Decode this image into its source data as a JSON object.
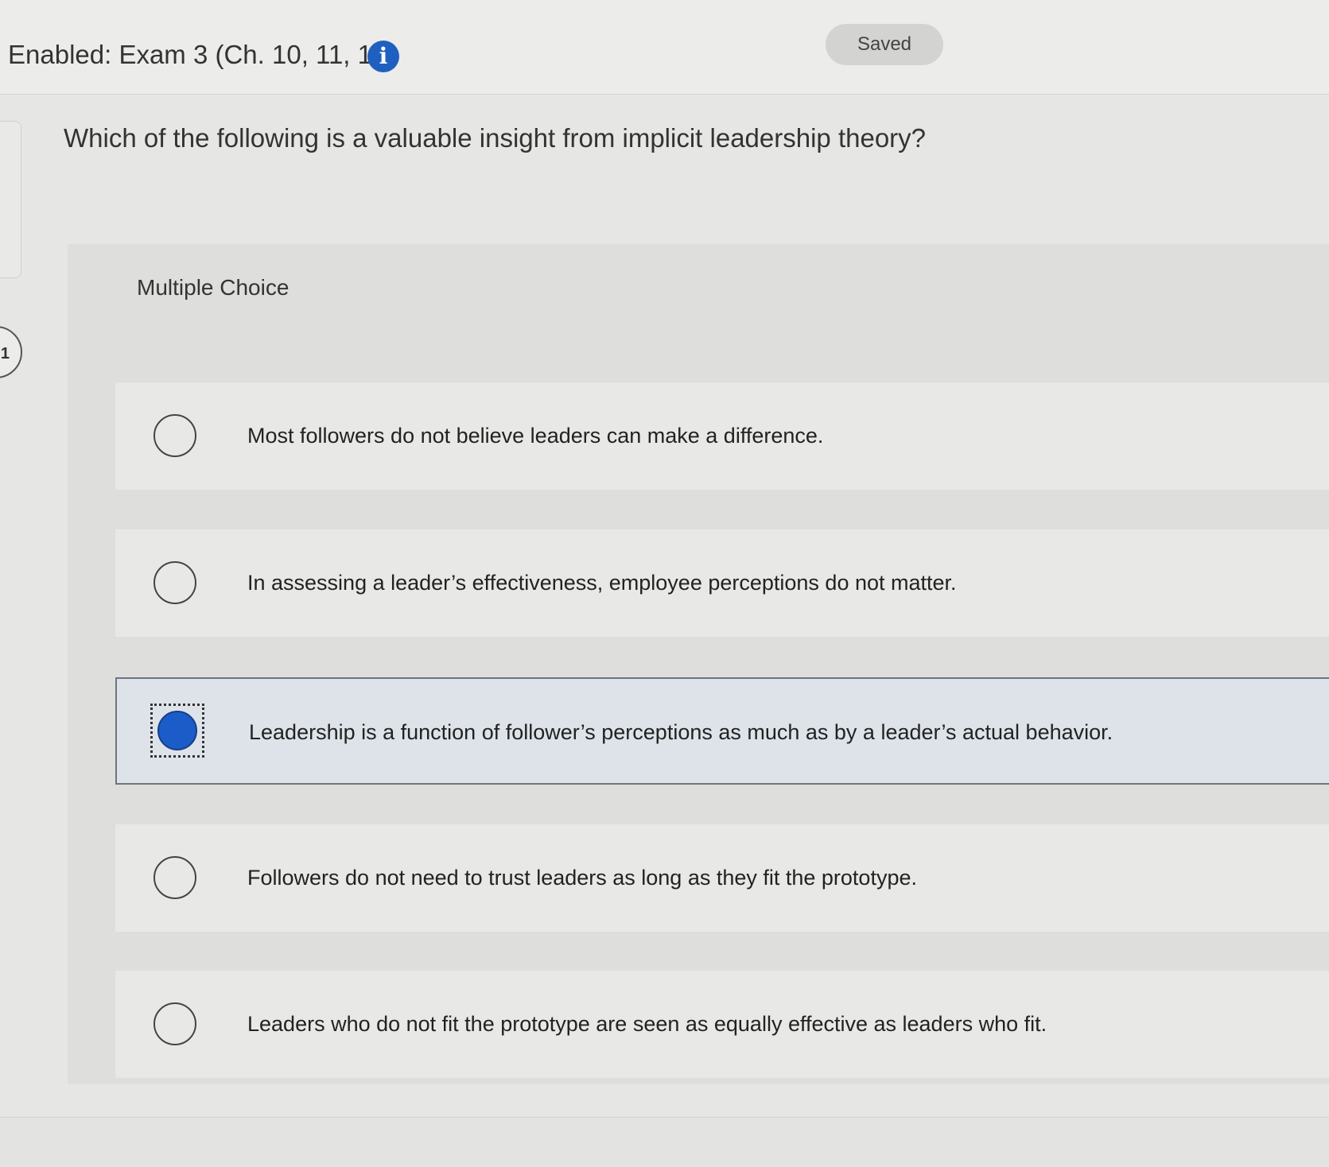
{
  "header": {
    "exam_title": "Enabled: Exam 3 (Ch. 10, 11, 12)",
    "info_icon_glyph": "i",
    "saved_label": "Saved"
  },
  "question": {
    "number": "1",
    "text": "Which of the following is a valuable insight from implicit leadership theory?",
    "type_label": "Multiple Choice",
    "options": [
      {
        "text": "Most followers do not believe leaders can make a difference.",
        "selected": false
      },
      {
        "text": "In assessing a leader’s effectiveness, employee perceptions do not matter.",
        "selected": false
      },
      {
        "text": "Leadership is a function of follower’s perceptions as much as by a leader’s actual behavior.",
        "selected": true
      },
      {
        "text": "Followers do not need to trust leaders as long as they fit the prototype.",
        "selected": false
      },
      {
        "text": "Leaders who do not fit the prototype are seen as equally effective as leaders who fit.",
        "selected": false
      }
    ]
  },
  "colors": {
    "accent": "#1c5cc8",
    "info_icon": "#1f5fbf",
    "selected_background": "#dde3e9"
  }
}
